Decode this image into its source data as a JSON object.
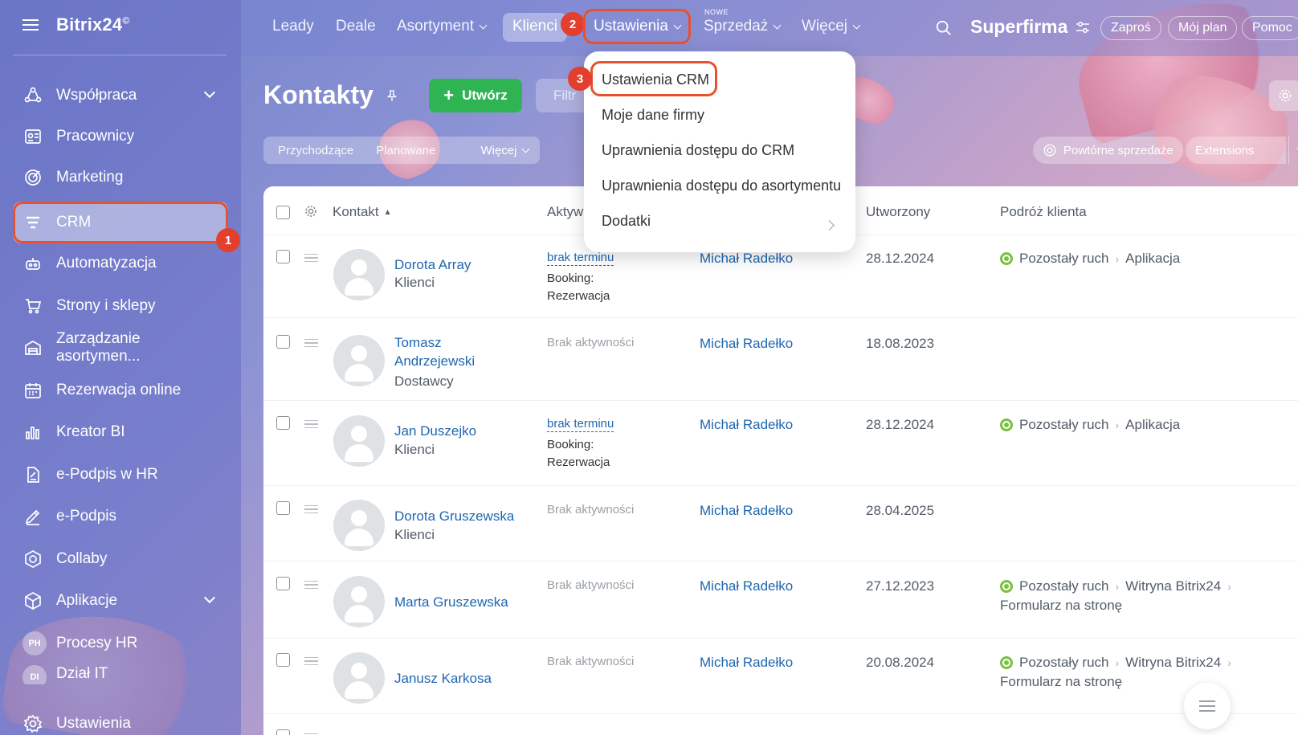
{
  "app": {
    "logo": "Bitrix24",
    "logo_mark": "©"
  },
  "sidebar": {
    "items": [
      {
        "label": "Współpraca",
        "icon": "collaboration-icon"
      },
      {
        "label": "Pracownicy",
        "icon": "employees-icon"
      },
      {
        "label": "Marketing",
        "icon": "marketing-icon"
      },
      {
        "label": "CRM",
        "icon": "crm-icon"
      },
      {
        "label": "Automatyzacja",
        "icon": "automation-icon"
      },
      {
        "label": "Strony i sklepy",
        "icon": "cart-icon"
      },
      {
        "label": "Zarządzanie asortymen...",
        "icon": "inventory-icon"
      },
      {
        "label": "Rezerwacja online",
        "icon": "calendar-icon"
      },
      {
        "label": "Kreator BI",
        "icon": "chart-icon"
      },
      {
        "label": "e-Podpis w HR",
        "icon": "document-sign-icon"
      },
      {
        "label": "e-Podpis",
        "icon": "pen-icon"
      },
      {
        "label": "Collaby",
        "icon": "hexagon-icon"
      },
      {
        "label": "Aplikacje",
        "icon": "cube-icon"
      },
      {
        "label": "Procesy HR",
        "avatar": "PH"
      },
      {
        "label": "Dział IT",
        "avatar": "DI"
      },
      {
        "label": "Ustawienia",
        "icon": "gear-icon"
      }
    ]
  },
  "topnav": {
    "items": [
      "Leady",
      "Deale",
      "Asortyment",
      "Klienci",
      "Ustawienia",
      "Sprzedaż",
      "Więcej"
    ],
    "new_tag": "NOWE",
    "brand": "Superfirma",
    "buttons": [
      "Zaproś",
      "Mój plan",
      "Pomoc"
    ]
  },
  "badges": {
    "b1": "1",
    "b2": "2",
    "b3": "3"
  },
  "page": {
    "title": "Kontakty",
    "create_label": "Utwórz",
    "filter_placeholder": "Filtr",
    "subtabs": [
      "Przychodzące",
      "Planowane",
      "Więcej"
    ],
    "repeat_sales": "Powtórne sprzedaże",
    "extensions": "Extensions"
  },
  "menu": {
    "items": [
      "Ustawienia CRM",
      "Moje dane firmy",
      "Uprawnienia dostępu do CRM",
      "Uprawnienia dostępu do asortymentu",
      "Dodatki"
    ]
  },
  "table": {
    "headers": {
      "contact": "Kontakt",
      "activity": "Aktyw",
      "created": "Utworzony",
      "journey": "Podróż klienta"
    },
    "rows": [
      {
        "name": "Dorota Array",
        "type": "Klienci",
        "activity_link": "brak terminu",
        "activity_text": "Booking: Rezerwacja",
        "responsible": "Michał Radełko",
        "created": "28.12.2024",
        "journey": [
          "Pozostały ruch",
          "Aplikacja"
        ]
      },
      {
        "name": "Tomasz Andrzejewski",
        "type": "Dostawcy",
        "activity_none": "Brak aktywności",
        "responsible": "Michał Radełko",
        "created": "18.08.2023"
      },
      {
        "name": "Jan Duszejko",
        "type": "Klienci",
        "activity_link": "brak terminu",
        "activity_text": "Booking: Rezerwacja",
        "responsible": "Michał Radełko",
        "created": "28.12.2024",
        "journey": [
          "Pozostały ruch",
          "Aplikacja"
        ]
      },
      {
        "name": "Dorota Gruszewska",
        "type": "Klienci",
        "activity_none": "Brak aktywności",
        "responsible": "Michał Radełko",
        "created": "28.04.2025"
      },
      {
        "name": "Marta Gruszewska",
        "activity_none": "Brak aktywności",
        "responsible": "Michał Radełko",
        "created": "27.12.2023",
        "journey": [
          "Pozostały ruch",
          "Witryna Bitrix24",
          "Formularz na stronę"
        ]
      },
      {
        "name": "Janusz Karkosa",
        "activity_none": "Brak aktywności",
        "responsible": "Michał Radełko",
        "created": "20.08.2024",
        "journey": [
          "Pozostały ruch",
          "Witryna Bitrix24",
          "Formularz na stronę"
        ]
      }
    ]
  },
  "colors": {
    "highlight": "#e8512e",
    "badge": "#e23f2f",
    "create_button": "#2fb454",
    "link": "#2067b0"
  }
}
